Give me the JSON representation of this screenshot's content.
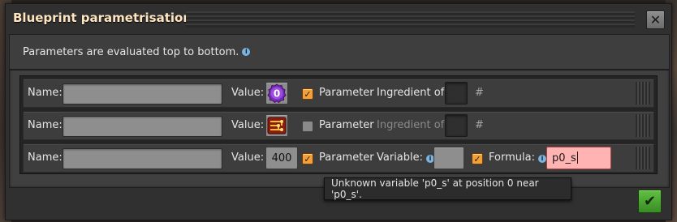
{
  "window": {
    "title": "Blueprint parametrisation",
    "close_glyph": "✕",
    "confirm_glyph": "✔"
  },
  "header": {
    "text": "Parameters are evaluated top to bottom.",
    "info_glyph": "i"
  },
  "labels": {
    "name": "Name:",
    "value": "Value:",
    "parameter": "Parameter",
    "ingredient_of": "Ingredient of:",
    "variable": "Variable:",
    "formula": "Formula:",
    "hash": "#"
  },
  "rows": [
    {
      "name": "",
      "value_icon": "signal-0-icon",
      "value_icon_text": "0",
      "parameter_checked": true,
      "ingredient_of_enabled": true
    },
    {
      "name": "",
      "value_icon": "electronic-circuit-icon",
      "parameter_checked": false,
      "ingredient_of_enabled": false
    },
    {
      "name": "",
      "value": "400",
      "parameter_checked": true,
      "variable": "",
      "formula_checked": true,
      "formula": "p0_s"
    }
  ],
  "tooltip": {
    "text": "Unknown variable 'p0_s' at position 0 near 'p0_s'."
  },
  "colors": {
    "accent_orange": "#f2a13a",
    "title_text": "#ffe6c0",
    "confirm_green": "#4caf33",
    "error_input": "#ffb3b3",
    "info_blue": "#7bb4e0"
  }
}
